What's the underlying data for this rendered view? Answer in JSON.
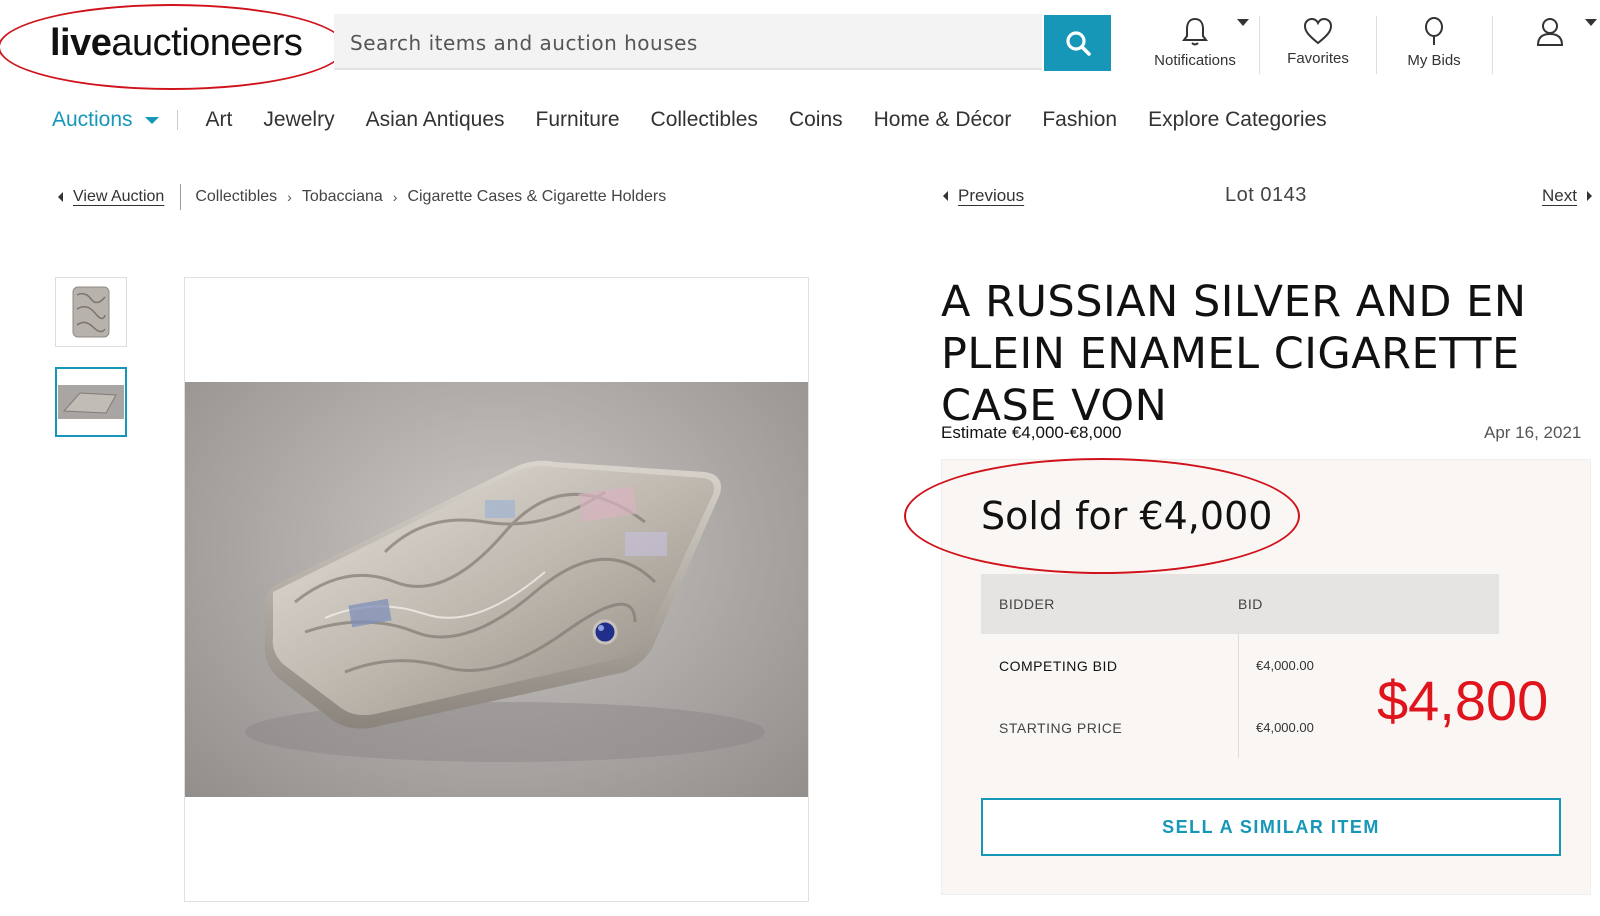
{
  "header": {
    "logo_bold": "live",
    "logo_rest": "auctioneers",
    "search_placeholder": "Search items and auction houses",
    "notifications_label": "Notifications",
    "favorites_label": "Favorites",
    "my_bids_label": "My Bids"
  },
  "nav": {
    "auctions": "Auctions",
    "items": [
      "Art",
      "Jewelry",
      "Asian Antiques",
      "Furniture",
      "Collectibles",
      "Coins",
      "Home & Décor",
      "Fashion",
      "Explore Categories"
    ]
  },
  "breadcrumb": {
    "view_auction": "View Auction",
    "path": [
      "Collectibles",
      "Tobacciana",
      "Cigarette Cases & Cigarette Holders"
    ],
    "separator": "›"
  },
  "lot_nav": {
    "previous": "Previous",
    "lot_number": "Lot 0143",
    "next": "Next"
  },
  "item": {
    "title": "A RUSSIAN SILVER AND EN PLEIN ENAMEL CIGARETTE CASE VON",
    "estimate": "Estimate €4,000-€8,000",
    "date": "Apr 16, 2021",
    "sold_text": "Sold for €4,000",
    "annotation_usd": "$4,800"
  },
  "bid_table": {
    "headers": [
      "BIDDER",
      "BID"
    ],
    "rows": [
      {
        "bidder": "COMPETING BID",
        "bid": "€4,000.00"
      },
      {
        "bidder": "STARTING PRICE",
        "bid": "€4,000.00"
      }
    ]
  },
  "actions": {
    "sell_similar": "SELL A SIMILAR ITEM"
  },
  "colors": {
    "brand_teal": "#1797b8",
    "annotation_red": "#e0141c",
    "panel_bg": "#faf6f4"
  }
}
